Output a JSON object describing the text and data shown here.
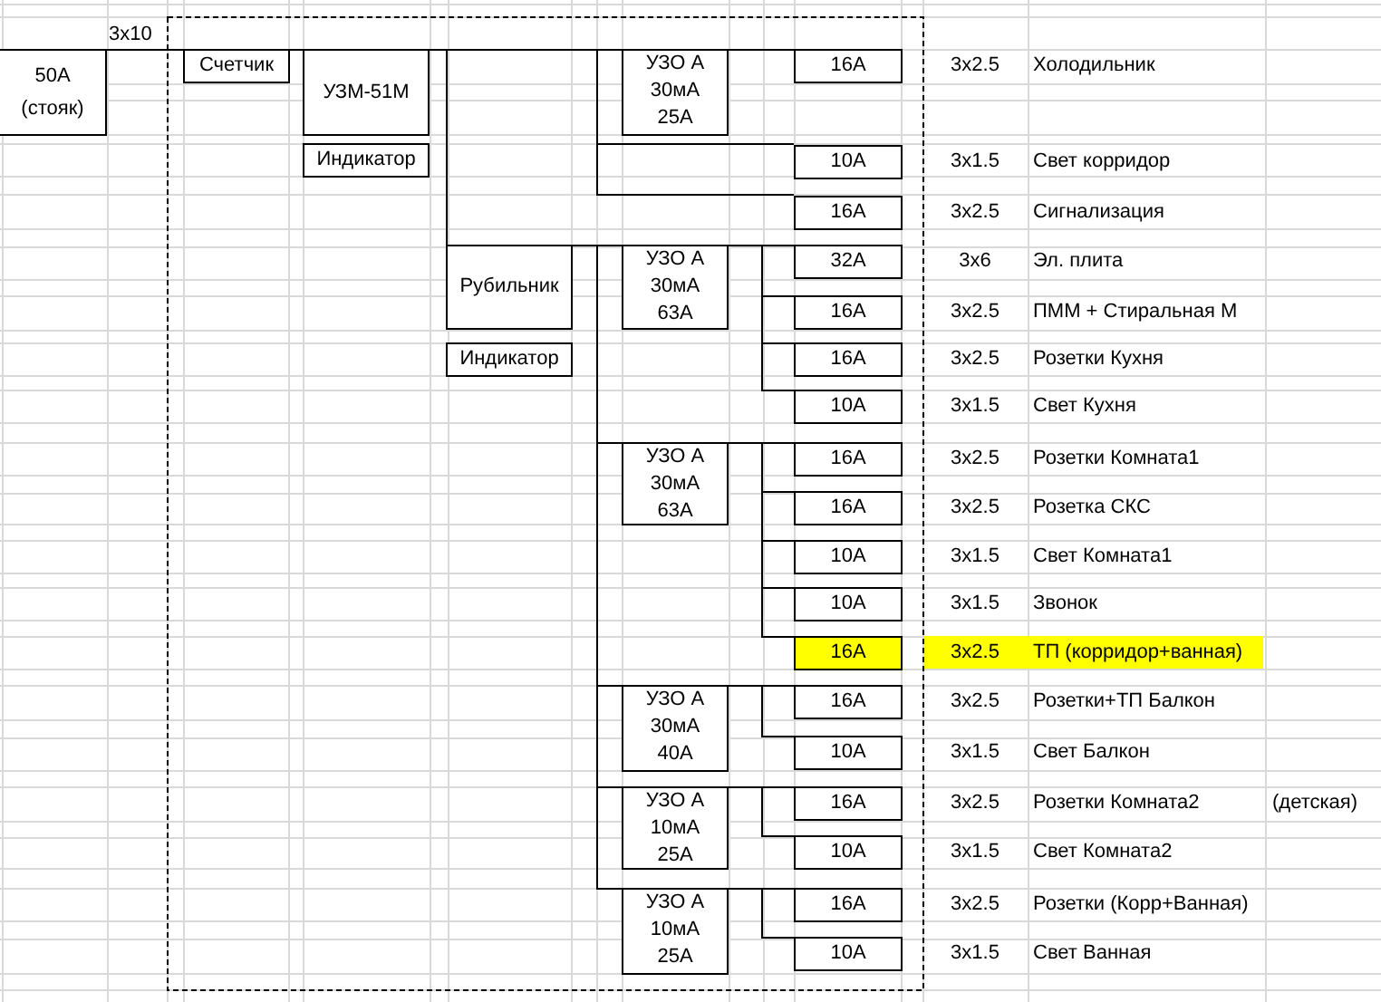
{
  "riser": {
    "lines": [
      "50A",
      "(стояк)"
    ]
  },
  "feed_cable": "3x10",
  "meter": "Счетчик",
  "relay": "УЗМ-51М",
  "relay_indicator": "Индикатор",
  "main_switch": "Рубильник",
  "switch_indicator": "Индикатор",
  "rcds": [
    {
      "lines": [
        "УЗО А",
        "30мА",
        "25А"
      ]
    },
    {
      "lines": [
        "УЗО А",
        "30мА",
        "63А"
      ]
    },
    {
      "lines": [
        "УЗО А",
        "30мА",
        "63А"
      ]
    },
    {
      "lines": [
        "УЗО А",
        "30мА",
        "40А"
      ]
    },
    {
      "lines": [
        "УЗО А",
        "10мА",
        "25А"
      ]
    },
    {
      "lines": [
        "УЗО А",
        "10мА",
        "25А"
      ]
    }
  ],
  "circuits": [
    {
      "breaker": "16A",
      "cable": "3x2.5",
      "name": "Холодильник",
      "highlighted": false
    },
    {
      "breaker": "10A",
      "cable": "3x1.5",
      "name": "Свет корридор",
      "highlighted": false
    },
    {
      "breaker": "16A",
      "cable": "3x2.5",
      "name": "Сигнализация",
      "highlighted": false
    },
    {
      "breaker": "32A",
      "cable": "3x6",
      "name": "Эл. плита",
      "highlighted": false
    },
    {
      "breaker": "16A",
      "cable": "3x2.5",
      "name": "ПММ + Стиральная М",
      "highlighted": false
    },
    {
      "breaker": "16A",
      "cable": "3x2.5",
      "name": "Розетки Кухня",
      "highlighted": false
    },
    {
      "breaker": "10A",
      "cable": "3x1.5",
      "name": "Свет Кухня",
      "highlighted": false
    },
    {
      "breaker": "16A",
      "cable": "3x2.5",
      "name": "Розетки Комната1",
      "highlighted": false
    },
    {
      "breaker": "16A",
      "cable": "3x2.5",
      "name": "Розетка СКС",
      "highlighted": false
    },
    {
      "breaker": "10A",
      "cable": "3x1.5",
      "name": "Свет Комната1",
      "highlighted": false
    },
    {
      "breaker": "10A",
      "cable": "3x1.5",
      "name": "Звонок",
      "highlighted": false
    },
    {
      "breaker": "16A",
      "cable": "3x2.5",
      "name": "ТП (корридор+ванная)",
      "highlighted": true
    },
    {
      "breaker": "16A",
      "cable": "3x2.5",
      "name": "Розетки+ТП Балкон",
      "highlighted": false
    },
    {
      "breaker": "10A",
      "cable": "3x1.5",
      "name": "Свет Балкон",
      "highlighted": false
    },
    {
      "breaker": "16A",
      "cable": "3x2.5",
      "name": "Розетки Комната2",
      "note": "(детская)",
      "highlighted": false
    },
    {
      "breaker": "10A",
      "cable": "3x1.5",
      "name": "Свет Комната2",
      "highlighted": false
    },
    {
      "breaker": "16A",
      "cable": "3x2.5",
      "name": "Розетки (Корр+Ванная)",
      "highlighted": false
    },
    {
      "breaker": "10A",
      "cable": "3x1.5",
      "name": "Свет Ванная",
      "highlighted": false
    }
  ]
}
